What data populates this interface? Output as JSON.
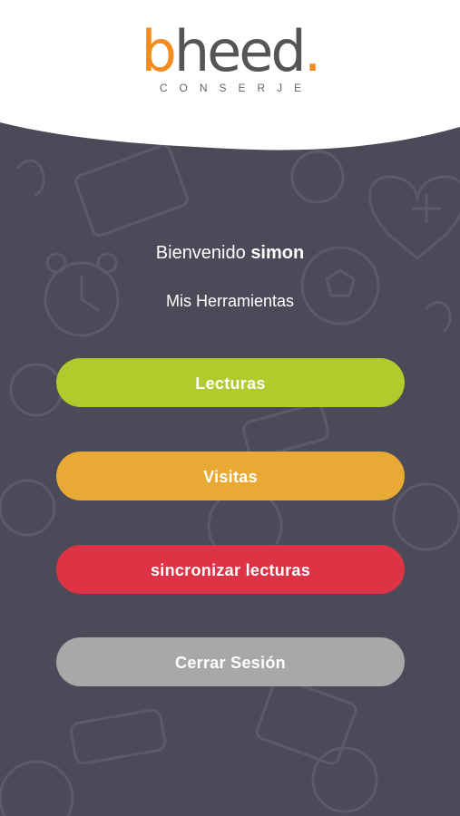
{
  "logo": {
    "brand_b": "b",
    "brand_rest": "heed",
    "brand_dot": ".",
    "subtitle": "CONSERJE"
  },
  "welcome": {
    "greeting": "Bienvenido",
    "username": "simon"
  },
  "tools_label": "Mis Herramientas",
  "buttons": {
    "lecturas": "Lecturas",
    "visitas": "Visitas",
    "sync": "sincronizar lecturas",
    "logout": "Cerrar Sesión"
  },
  "colors": {
    "brand_orange": "#f28c1e",
    "background": "#4a4a58",
    "lecturas": "#afcb2c",
    "visitas": "#e8a935",
    "sync": "#dd3345",
    "logout": "#a8a8a8"
  }
}
